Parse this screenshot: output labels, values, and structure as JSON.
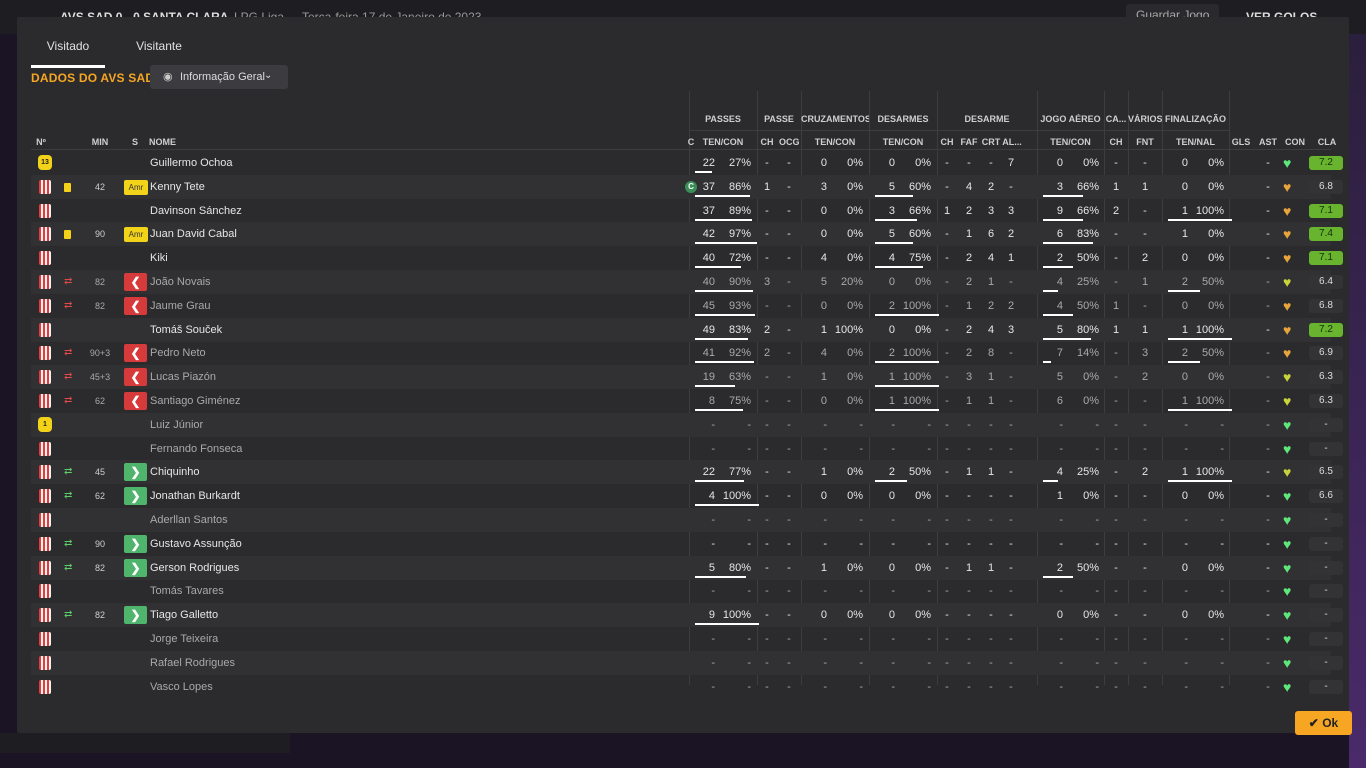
{
  "topbar": {
    "match": "AVS SAD  0 - 0  SANTA CLARA",
    "competition": "LPG Liga",
    "date": "Terça-feira 17 de Janeiro de 2023",
    "save_label": "Guardar Jogo",
    "goals_label": "VER GOLOS"
  },
  "tabs": [
    {
      "label": "Visitado",
      "active": true
    },
    {
      "label": "Visitante",
      "active": false
    }
  ],
  "team_title": "DADOS DO AVS SAD",
  "view_dropdown": "Informação Geral",
  "groups": [
    "PASSES",
    "PASSE",
    "CRUZAMENTOS",
    "DESARMES",
    "DESARME",
    "JOGO AÉREO",
    "CA...",
    "VÁRIOS",
    "FINALIZAÇÃO"
  ],
  "columns": {
    "num": "Nº",
    "min": "MIN",
    "s": "S",
    "name": "NOME",
    "c": "C",
    "passes": "TEN/CON",
    "passe_ch": "CH",
    "passe_ocg": "OCG",
    "cruz": "TEN/CON",
    "desarmes": "TEN/CON",
    "des_ch": "CH",
    "des_faf": "FAF",
    "des_crt": "CRT",
    "des_al": "AL...",
    "aereo": "TEN/CON",
    "ca_ch": "CH",
    "fnt": "FNT",
    "fin": "TEN/NAL",
    "gls": "GLS",
    "ast": "AST",
    "con": "CON",
    "cla": "CLA"
  },
  "ok_label": "Ok",
  "colors": {
    "accent": "#f6a623",
    "rating_good": "#68b42e",
    "sub_off": "#d63a3a",
    "sub_in": "#4fb56d"
  },
  "players": [
    {
      "shirt": "gk",
      "gk_num": "13",
      "card": "",
      "sub": "",
      "min": "",
      "badge": "",
      "name": "Guillermo Ochoa",
      "muted": false,
      "capt": false,
      "pass": [
        "22",
        "27%"
      ],
      "passe": [
        "-",
        "-"
      ],
      "cruz": [
        "0",
        "0%"
      ],
      "des": [
        "0",
        "0%"
      ],
      "d4": [
        "-",
        "-",
        "-",
        "7"
      ],
      "aer": [
        "0",
        "0%"
      ],
      "ca": "-",
      "fnt": "-",
      "fin": [
        "0",
        "0%"
      ],
      "gls": "",
      "ast": "-",
      "con": "green",
      "cla": "7.2",
      "cla_good": true,
      "bp": 0.27,
      "bd": 0,
      "ba": 0,
      "bf": 0
    },
    {
      "shirt": "s",
      "card": "y",
      "sub": "",
      "min": "42",
      "badge": "Amr",
      "name": "Kenny Tete",
      "muted": false,
      "capt": true,
      "capt_label": "C",
      "pass": [
        "37",
        "86%"
      ],
      "passe": [
        "1",
        "-"
      ],
      "cruz": [
        "3",
        "0%"
      ],
      "des": [
        "5",
        "60%"
      ],
      "d4": [
        "-",
        "4",
        "2",
        "-"
      ],
      "aer": [
        "3",
        "66%"
      ],
      "ca": "1",
      "fnt": "1",
      "fin": [
        "0",
        "0%"
      ],
      "gls": "",
      "ast": "-",
      "con": "orange",
      "cla": "6.8",
      "cla_good": false,
      "bp": 0.86,
      "bd": 0.6,
      "ba": 0.66,
      "bf": 0
    },
    {
      "shirt": "s",
      "card": "",
      "sub": "",
      "min": "",
      "badge": "",
      "name": "Davinson Sánchez",
      "muted": false,
      "capt": false,
      "pass": [
        "37",
        "89%"
      ],
      "passe": [
        "-",
        "-"
      ],
      "cruz": [
        "0",
        "0%"
      ],
      "des": [
        "3",
        "66%"
      ],
      "d4": [
        "1",
        "2",
        "3",
        "3"
      ],
      "aer": [
        "9",
        "66%"
      ],
      "ca": "2",
      "fnt": "-",
      "fin": [
        "1",
        "100%"
      ],
      "gls": "",
      "ast": "-",
      "con": "orange",
      "cla": "7.1",
      "cla_good": true,
      "bp": 0.89,
      "bd": 0.66,
      "ba": 0.66,
      "bf": 1
    },
    {
      "shirt": "s",
      "card": "y",
      "sub": "",
      "min": "90",
      "badge": "Amr",
      "name": "Juan David Cabal",
      "muted": false,
      "capt": false,
      "pass": [
        "42",
        "97%"
      ],
      "passe": [
        "-",
        "-"
      ],
      "cruz": [
        "0",
        "0%"
      ],
      "des": [
        "5",
        "60%"
      ],
      "d4": [
        "-",
        "1",
        "6",
        "2"
      ],
      "aer": [
        "6",
        "83%"
      ],
      "ca": "-",
      "fnt": "-",
      "fin": [
        "1",
        "0%"
      ],
      "gls": "",
      "ast": "-",
      "con": "orange",
      "cla": "7.4",
      "cla_good": true,
      "bp": 0.97,
      "bd": 0.6,
      "ba": 0.83,
      "bf": 0
    },
    {
      "shirt": "s",
      "card": "",
      "sub": "",
      "min": "",
      "badge": "",
      "name": "Kiki",
      "muted": false,
      "capt": false,
      "pass": [
        "40",
        "72%"
      ],
      "passe": [
        "-",
        "-"
      ],
      "cruz": [
        "4",
        "0%"
      ],
      "des": [
        "4",
        "75%"
      ],
      "d4": [
        "-",
        "2",
        "4",
        "1"
      ],
      "aer": [
        "2",
        "50%"
      ],
      "ca": "-",
      "fnt": "2",
      "fin": [
        "0",
        "0%"
      ],
      "gls": "",
      "ast": "-",
      "con": "orange",
      "cla": "7.1",
      "cla_good": true,
      "bp": 0.72,
      "bd": 0.75,
      "ba": 0.5,
      "bf": 0
    },
    {
      "shirt": "s",
      "card": "",
      "sub": "off",
      "min": "82",
      "badge": "out",
      "name": "João Novais",
      "muted": true,
      "capt": false,
      "pass": [
        "40",
        "90%"
      ],
      "passe": [
        "3",
        "-"
      ],
      "cruz": [
        "5",
        "20%"
      ],
      "des": [
        "0",
        "0%"
      ],
      "d4": [
        "-",
        "2",
        "1",
        "-"
      ],
      "aer": [
        "4",
        "25%"
      ],
      "ca": "-",
      "fnt": "1",
      "fin": [
        "2",
        "50%"
      ],
      "gls": "",
      "ast": "-",
      "con": "yellow",
      "cla": "6.4",
      "cla_good": false,
      "bp": 0.9,
      "bd": 0,
      "ba": 0.25,
      "bf": 0.5
    },
    {
      "shirt": "s",
      "card": "",
      "sub": "off",
      "min": "82",
      "badge": "out",
      "name": "Jaume Grau",
      "muted": true,
      "capt": false,
      "pass": [
        "45",
        "93%"
      ],
      "passe": [
        "-",
        "-"
      ],
      "cruz": [
        "0",
        "0%"
      ],
      "des": [
        "2",
        "100%"
      ],
      "d4": [
        "-",
        "1",
        "2",
        "2"
      ],
      "aer": [
        "4",
        "50%"
      ],
      "ca": "1",
      "fnt": "-",
      "fin": [
        "0",
        "0%"
      ],
      "gls": "",
      "ast": "-",
      "con": "orange",
      "cla": "6.8",
      "cla_good": false,
      "bp": 0.93,
      "bd": 1,
      "ba": 0.5,
      "bf": 0
    },
    {
      "shirt": "s",
      "card": "",
      "sub": "",
      "min": "",
      "badge": "",
      "name": "Tomáš Souček",
      "muted": false,
      "capt": false,
      "pass": [
        "49",
        "83%"
      ],
      "passe": [
        "2",
        "-"
      ],
      "cruz": [
        "1",
        "100%"
      ],
      "des": [
        "0",
        "0%"
      ],
      "d4": [
        "-",
        "2",
        "4",
        "3"
      ],
      "aer": [
        "5",
        "80%"
      ],
      "ca": "1",
      "fnt": "1",
      "fin": [
        "1",
        "100%"
      ],
      "gls": "",
      "ast": "-",
      "con": "orange",
      "cla": "7.2",
      "cla_good": true,
      "bp": 0.83,
      "bd": 0,
      "ba": 0.8,
      "bf": 1
    },
    {
      "shirt": "s",
      "card": "",
      "sub": "off",
      "min": "90+3",
      "badge": "out",
      "name": "Pedro Neto",
      "muted": true,
      "capt": false,
      "pass": [
        "41",
        "92%"
      ],
      "passe": [
        "2",
        "-"
      ],
      "cruz": [
        "4",
        "0%"
      ],
      "des": [
        "2",
        "100%"
      ],
      "d4": [
        "-",
        "2",
        "8",
        "-"
      ],
      "aer": [
        "7",
        "14%"
      ],
      "ca": "-",
      "fnt": "3",
      "fin": [
        "2",
        "50%"
      ],
      "gls": "",
      "ast": "-",
      "con": "orange",
      "cla": "6.9",
      "cla_good": false,
      "bp": 0.92,
      "bd": 1,
      "ba": 0.14,
      "bf": 0.5
    },
    {
      "shirt": "s",
      "card": "",
      "sub": "off",
      "min": "45+3",
      "badge": "out",
      "name": "Lucas Piazón",
      "muted": true,
      "capt": false,
      "pass": [
        "19",
        "63%"
      ],
      "passe": [
        "-",
        "-"
      ],
      "cruz": [
        "1",
        "0%"
      ],
      "des": [
        "1",
        "100%"
      ],
      "d4": [
        "-",
        "3",
        "1",
        "-"
      ],
      "aer": [
        "5",
        "0%"
      ],
      "ca": "-",
      "fnt": "2",
      "fin": [
        "0",
        "0%"
      ],
      "gls": "",
      "ast": "-",
      "con": "yellow",
      "cla": "6.3",
      "cla_good": false,
      "bp": 0.63,
      "bd": 1,
      "ba": 0,
      "bf": 0
    },
    {
      "shirt": "s",
      "card": "",
      "sub": "off",
      "min": "62",
      "badge": "out",
      "name": "Santiago Giménez",
      "muted": true,
      "capt": false,
      "pass": [
        "8",
        "75%"
      ],
      "passe": [
        "-",
        "-"
      ],
      "cruz": [
        "0",
        "0%"
      ],
      "des": [
        "1",
        "100%"
      ],
      "d4": [
        "-",
        "1",
        "1",
        "-"
      ],
      "aer": [
        "6",
        "0%"
      ],
      "ca": "-",
      "fnt": "-",
      "fin": [
        "1",
        "100%"
      ],
      "gls": "",
      "ast": "-",
      "con": "yellow",
      "cla": "6.3",
      "cla_good": false,
      "bp": 0.75,
      "bd": 1,
      "ba": 0,
      "bf": 1
    },
    {
      "shirt": "gk",
      "gk_num": "1",
      "card": "",
      "sub": "",
      "min": "",
      "badge": "",
      "name": "Luiz Júnior",
      "muted": true,
      "capt": false,
      "pass": [
        "-",
        "-"
      ],
      "passe": [
        "-",
        "-"
      ],
      "cruz": [
        "-",
        "-"
      ],
      "des": [
        "-",
        "-"
      ],
      "d4": [
        "-",
        "-",
        "-",
        "-"
      ],
      "aer": [
        "-",
        "-"
      ],
      "ca": "-",
      "fnt": "-",
      "fin": [
        "-",
        "-"
      ],
      "gls": "",
      "ast": "-",
      "con": "green",
      "cla": "-",
      "cla_good": false,
      "bp": 0,
      "bd": 0,
      "ba": 0,
      "bf": 0
    },
    {
      "shirt": "s",
      "card": "",
      "sub": "",
      "min": "",
      "badge": "",
      "name": "Fernando Fonseca",
      "muted": true,
      "capt": false,
      "pass": [
        "-",
        "-"
      ],
      "passe": [
        "-",
        "-"
      ],
      "cruz": [
        "-",
        "-"
      ],
      "des": [
        "-",
        "-"
      ],
      "d4": [
        "-",
        "-",
        "-",
        "-"
      ],
      "aer": [
        "-",
        "-"
      ],
      "ca": "-",
      "fnt": "-",
      "fin": [
        "-",
        "-"
      ],
      "gls": "",
      "ast": "-",
      "con": "green",
      "cla": "-",
      "cla_good": false,
      "bp": 0,
      "bd": 0,
      "ba": 0,
      "bf": 0
    },
    {
      "shirt": "s",
      "card": "",
      "sub": "on",
      "min": "45",
      "badge": "in",
      "name": "Chiquinho",
      "muted": false,
      "capt": false,
      "pass": [
        "22",
        "77%"
      ],
      "passe": [
        "-",
        "-"
      ],
      "cruz": [
        "1",
        "0%"
      ],
      "des": [
        "2",
        "50%"
      ],
      "d4": [
        "-",
        "1",
        "1",
        "-"
      ],
      "aer": [
        "4",
        "25%"
      ],
      "ca": "-",
      "fnt": "2",
      "fin": [
        "1",
        "100%"
      ],
      "gls": "",
      "ast": "-",
      "con": "yellow",
      "cla": "6.5",
      "cla_good": false,
      "bp": 0.77,
      "bd": 0.5,
      "ba": 0.25,
      "bf": 1
    },
    {
      "shirt": "s",
      "card": "",
      "sub": "on",
      "min": "62",
      "badge": "in",
      "name": "Jonathan Burkardt",
      "muted": false,
      "capt": false,
      "pass": [
        "4",
        "100%"
      ],
      "passe": [
        "-",
        "-"
      ],
      "cruz": [
        "0",
        "0%"
      ],
      "des": [
        "0",
        "0%"
      ],
      "d4": [
        "-",
        "-",
        "-",
        "-"
      ],
      "aer": [
        "1",
        "0%"
      ],
      "ca": "-",
      "fnt": "-",
      "fin": [
        "0",
        "0%"
      ],
      "gls": "",
      "ast": "-",
      "con": "green",
      "cla": "6.6",
      "cla_good": false,
      "bp": 1,
      "bd": 0,
      "ba": 0,
      "bf": 0
    },
    {
      "shirt": "s",
      "card": "",
      "sub": "",
      "min": "",
      "badge": "",
      "name": "Aderllan Santos",
      "muted": true,
      "capt": false,
      "pass": [
        "-",
        "-"
      ],
      "passe": [
        "-",
        "-"
      ],
      "cruz": [
        "-",
        "-"
      ],
      "des": [
        "-",
        "-"
      ],
      "d4": [
        "-",
        "-",
        "-",
        "-"
      ],
      "aer": [
        "-",
        "-"
      ],
      "ca": "-",
      "fnt": "-",
      "fin": [
        "-",
        "-"
      ],
      "gls": "",
      "ast": "-",
      "con": "green",
      "cla": "-",
      "cla_good": false,
      "bp": 0,
      "bd": 0,
      "ba": 0,
      "bf": 0
    },
    {
      "shirt": "s",
      "card": "",
      "sub": "on",
      "min": "90",
      "badge": "in",
      "name": "Gustavo Assunção",
      "muted": false,
      "capt": false,
      "pass": [
        "-",
        "-"
      ],
      "passe": [
        "-",
        "-"
      ],
      "cruz": [
        "-",
        "-"
      ],
      "des": [
        "-",
        "-"
      ],
      "d4": [
        "-",
        "-",
        "-",
        "-"
      ],
      "aer": [
        "-",
        "-"
      ],
      "ca": "-",
      "fnt": "-",
      "fin": [
        "-",
        "-"
      ],
      "gls": "",
      "ast": "-",
      "con": "green",
      "cla": "-",
      "cla_good": false,
      "bp": 0,
      "bd": 0,
      "ba": 0,
      "bf": 0
    },
    {
      "shirt": "s",
      "card": "",
      "sub": "on",
      "min": "82",
      "badge": "in",
      "name": "Gerson Rodrigues",
      "muted": false,
      "capt": false,
      "pass": [
        "5",
        "80%"
      ],
      "passe": [
        "-",
        "-"
      ],
      "cruz": [
        "1",
        "0%"
      ],
      "des": [
        "0",
        "0%"
      ],
      "d4": [
        "-",
        "1",
        "1",
        "-"
      ],
      "aer": [
        "2",
        "50%"
      ],
      "ca": "-",
      "fnt": "-",
      "fin": [
        "0",
        "0%"
      ],
      "gls": "",
      "ast": "-",
      "con": "green",
      "cla": "-",
      "cla_good": false,
      "bp": 0.8,
      "bd": 0,
      "ba": 0.5,
      "bf": 0
    },
    {
      "shirt": "s",
      "card": "",
      "sub": "",
      "min": "",
      "badge": "",
      "name": "Tomás Tavares",
      "muted": true,
      "capt": false,
      "pass": [
        "-",
        "-"
      ],
      "passe": [
        "-",
        "-"
      ],
      "cruz": [
        "-",
        "-"
      ],
      "des": [
        "-",
        "-"
      ],
      "d4": [
        "-",
        "-",
        "-",
        "-"
      ],
      "aer": [
        "-",
        "-"
      ],
      "ca": "-",
      "fnt": "-",
      "fin": [
        "-",
        "-"
      ],
      "gls": "",
      "ast": "-",
      "con": "green",
      "cla": "-",
      "cla_good": false,
      "bp": 0,
      "bd": 0,
      "ba": 0,
      "bf": 0
    },
    {
      "shirt": "s",
      "card": "",
      "sub": "on",
      "min": "82",
      "badge": "in",
      "name": "Tiago Galletto",
      "muted": false,
      "capt": false,
      "pass": [
        "9",
        "100%"
      ],
      "passe": [
        "-",
        "-"
      ],
      "cruz": [
        "0",
        "0%"
      ],
      "des": [
        "0",
        "0%"
      ],
      "d4": [
        "-",
        "-",
        "-",
        "-"
      ],
      "aer": [
        "0",
        "0%"
      ],
      "ca": "-",
      "fnt": "-",
      "fin": [
        "0",
        "0%"
      ],
      "gls": "",
      "ast": "-",
      "con": "green",
      "cla": "-",
      "cla_good": false,
      "bp": 1,
      "bd": 0,
      "ba": 0,
      "bf": 0
    },
    {
      "shirt": "s",
      "card": "",
      "sub": "",
      "min": "",
      "badge": "",
      "name": "Jorge Teixeira",
      "muted": true,
      "capt": false,
      "pass": [
        "-",
        "-"
      ],
      "passe": [
        "-",
        "-"
      ],
      "cruz": [
        "-",
        "-"
      ],
      "des": [
        "-",
        "-"
      ],
      "d4": [
        "-",
        "-",
        "-",
        "-"
      ],
      "aer": [
        "-",
        "-"
      ],
      "ca": "-",
      "fnt": "-",
      "fin": [
        "-",
        "-"
      ],
      "gls": "",
      "ast": "-",
      "con": "green",
      "cla": "-",
      "cla_good": false,
      "bp": 0,
      "bd": 0,
      "ba": 0,
      "bf": 0
    },
    {
      "shirt": "s",
      "card": "",
      "sub": "",
      "min": "",
      "badge": "",
      "name": "Rafael Rodrigues",
      "muted": true,
      "capt": false,
      "pass": [
        "-",
        "-"
      ],
      "passe": [
        "-",
        "-"
      ],
      "cruz": [
        "-",
        "-"
      ],
      "des": [
        "-",
        "-"
      ],
      "d4": [
        "-",
        "-",
        "-",
        "-"
      ],
      "aer": [
        "-",
        "-"
      ],
      "ca": "-",
      "fnt": "-",
      "fin": [
        "-",
        "-"
      ],
      "gls": "",
      "ast": "-",
      "con": "green",
      "cla": "-",
      "cla_good": false,
      "bp": 0,
      "bd": 0,
      "ba": 0,
      "bf": 0
    },
    {
      "shirt": "s",
      "card": "",
      "sub": "",
      "min": "",
      "badge": "",
      "name": "Vasco Lopes",
      "muted": true,
      "capt": false,
      "pass": [
        "-",
        "-"
      ],
      "passe": [
        "-",
        "-"
      ],
      "cruz": [
        "-",
        "-"
      ],
      "des": [
        "-",
        "-"
      ],
      "d4": [
        "-",
        "-",
        "-",
        "-"
      ],
      "aer": [
        "-",
        "-"
      ],
      "ca": "-",
      "fnt": "-",
      "fin": [
        "-",
        "-"
      ],
      "gls": "",
      "ast": "-",
      "con": "green",
      "cla": "-",
      "cla_good": false,
      "bp": 0,
      "bd": 0,
      "ba": 0,
      "bf": 0
    }
  ]
}
